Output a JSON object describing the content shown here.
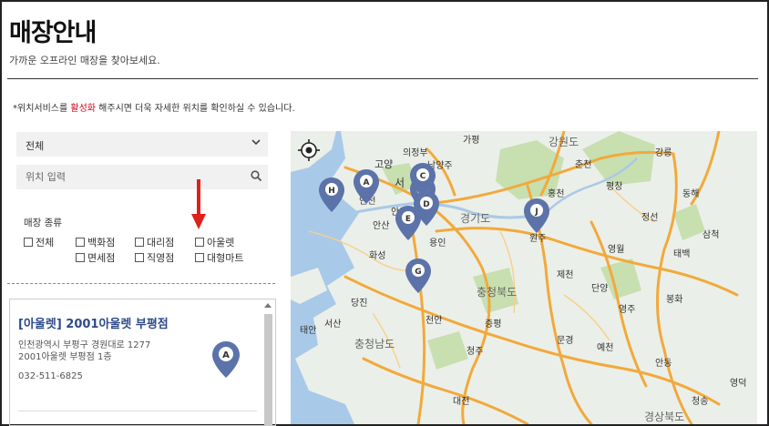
{
  "page": {
    "title": "매장안내",
    "subtitle": "가까운 오프라인 매장을 찾아보세요."
  },
  "notice": {
    "prefix": "*위치서비스를 ",
    "highlight": "활성화",
    "suffix": " 해주시면 더욱 자세한 위치를 확인하실 수 있습니다."
  },
  "filters": {
    "region_select": "전체",
    "location_placeholder": "위치 입력",
    "type_label": "매장 종류",
    "types": [
      "전체",
      "백화점",
      "대리점",
      "아울렛",
      "면세점",
      "직영점",
      "대형마트"
    ]
  },
  "store_list": [
    {
      "name": "[아울렛] 2001아울렛 부평점",
      "address_line1": "인천광역시 부평구 경원대로 1277",
      "address_line2": "2001아울렛 부평점 1층",
      "phone": "032-511-6825",
      "marker": "A"
    }
  ],
  "map": {
    "markers": [
      "A",
      "B",
      "C",
      "D",
      "E",
      "G",
      "H",
      "J"
    ],
    "labels": [
      "가평",
      "강원도",
      "춘천",
      "의정부",
      "남양주",
      "고양",
      "서",
      "홍천",
      "강릉",
      "횡성",
      "평창",
      "동해",
      "경기도",
      "인천",
      "안양",
      "안산",
      "용인",
      "원주",
      "정선",
      "영월",
      "태백",
      "화성",
      "제천",
      "충청북도",
      "단양",
      "삼척",
      "봉화",
      "영주",
      "천안",
      "증평",
      "태안",
      "서산",
      "충청남도",
      "문경",
      "예천",
      "청주",
      "안동",
      "당진",
      "영덕",
      "대전",
      "청송",
      "경상북도"
    ],
    "colors": {
      "marker": "#5b73a8",
      "road": "#f2a93b",
      "land": "#ebefe9",
      "water": "#a9c9e8",
      "park": "#c8dfb0"
    }
  }
}
